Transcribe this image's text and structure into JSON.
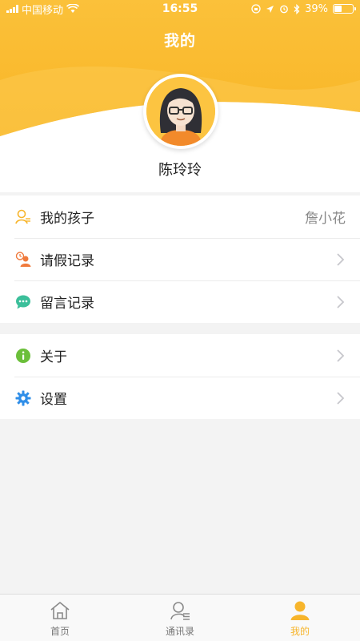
{
  "status_bar": {
    "carrier": "中国移动",
    "time": "16:55",
    "battery": "39%",
    "battery_level": 0.39
  },
  "header": {
    "title": "我的",
    "user_name": "陈玲玲"
  },
  "menu": {
    "group1": [
      {
        "label": "我的孩子",
        "value": "詹小花",
        "icon": "child-icon"
      },
      {
        "label": "请假记录",
        "icon": "leave-record-icon"
      },
      {
        "label": "留言记录",
        "icon": "message-icon"
      }
    ],
    "group2": [
      {
        "label": "关于",
        "icon": "info-icon"
      },
      {
        "label": "设置",
        "icon": "gear-icon"
      }
    ]
  },
  "tabbar": {
    "items": [
      {
        "label": "首页",
        "icon": "home-icon"
      },
      {
        "label": "通讯录",
        "icon": "contacts-icon"
      },
      {
        "label": "我的",
        "icon": "profile-icon",
        "active": true
      }
    ]
  },
  "colors": {
    "accent": "#f7b52c",
    "header_gradient": [
      "#fbc02d",
      "#f9b724"
    ],
    "info": "#6bbf3a",
    "settings": "#2f8ee8",
    "message": "#3bbf9a",
    "leave": "#f07a3c"
  }
}
